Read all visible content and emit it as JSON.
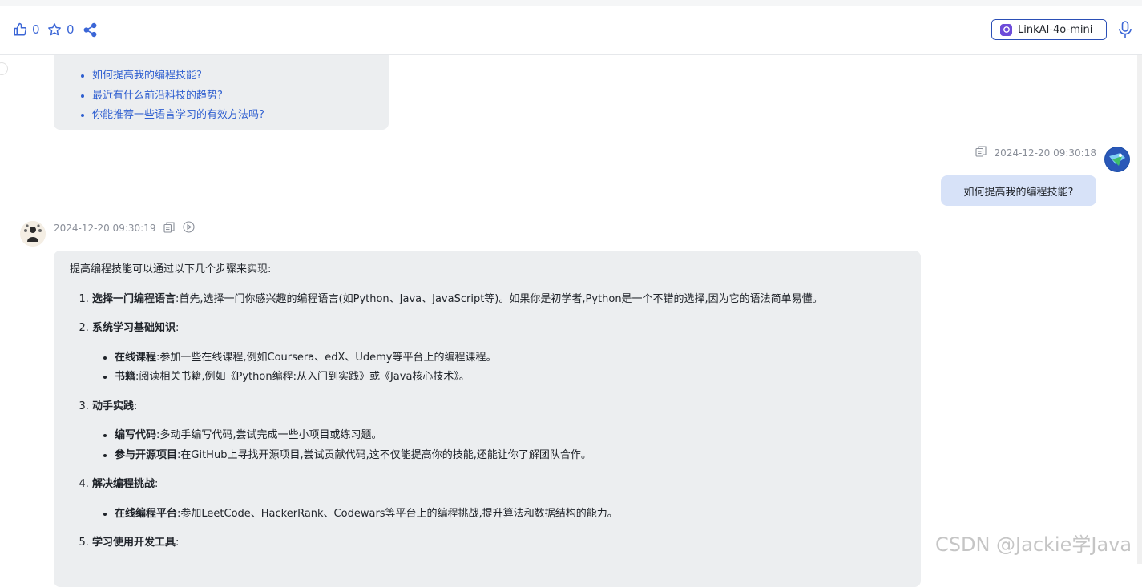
{
  "toolbar": {
    "like_count": "0",
    "star_count": "0",
    "model_name": "LinkAI-4o-mini"
  },
  "suggestions": [
    "如何提高我的编程技能?",
    "最近有什么前沿科技的趋势?",
    "你能推荐一些语言学习的有效方法吗?"
  ],
  "user_message": {
    "timestamp": "2024-12-20 09:30:18",
    "text": "如何提高我的编程技能?"
  },
  "bot_message": {
    "timestamp": "2024-12-20 09:30:19",
    "intro": "提高编程技能可以通过以下几个步骤来实现:",
    "steps": [
      {
        "title": "选择一门编程语言",
        "text": ":首先,选择一门你感兴趣的编程语言(如Python、Java、JavaScript等)。如果你是初学者,Python是一个不错的选择,因为它的语法简单易懂。",
        "items": []
      },
      {
        "title": "系统学习基础知识",
        "text": ":",
        "items": [
          {
            "title": "在线课程",
            "text": ":参加一些在线课程,例如Coursera、edX、Udemy等平台上的编程课程。"
          },
          {
            "title": "书籍",
            "text": ":阅读相关书籍,例如《Python编程:从入门到实践》或《Java核心技术》。"
          }
        ]
      },
      {
        "title": "动手实践",
        "text": ":",
        "items": [
          {
            "title": "编写代码",
            "text": ":多动手编写代码,尝试完成一些小项目或练习题。"
          },
          {
            "title": "参与开源项目",
            "text": ":在GitHub上寻找开源项目,尝试贡献代码,这不仅能提高你的技能,还能让你了解团队合作。"
          }
        ]
      },
      {
        "title": "解决编程挑战",
        "text": ":",
        "items": [
          {
            "title": "在线编程平台",
            "text": ":参加LeetCode、HackerRank、Codewars等平台上的编程挑战,提升算法和数据结构的能力。"
          }
        ]
      },
      {
        "title": "学习使用开发工具",
        "text": ":",
        "items": []
      }
    ]
  },
  "watermark": "CSDN @Jackie学Java"
}
